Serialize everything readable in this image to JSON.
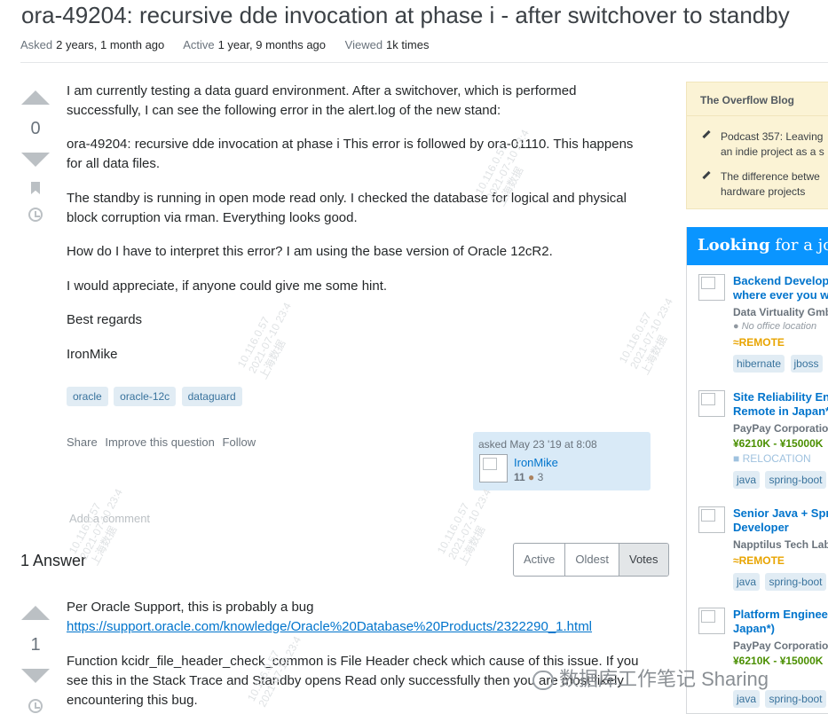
{
  "question": {
    "title": "ora-49204: recursive dde invocation at phase i - after switchover to standby",
    "asked_label": "Asked",
    "asked_value": "2 years, 1 month ago",
    "active_label": "Active",
    "active_value": "1 year, 9 months ago",
    "viewed_label": "Viewed",
    "viewed_value": "1k times",
    "score": "0",
    "paragraphs": [
      "I am currently testing a data guard environment. After a switchover, which is performed successfully, I can see the following error in the alert.log of the new stand:",
      "ora-49204: recursive dde invocation at phase i This error is followed by ora-01110. This happens for all data files.",
      "The standby is running in open mode read only. I checked the database for logical and physical block corruption via rman. Everything looks good.",
      "How do I have to interpret this error? I am using the base version of Oracle 12cR2.",
      "I would appreciate, if anyone could give me some hint.",
      "Best regards",
      "IronMike"
    ],
    "tags": [
      "oracle",
      "oracle-12c",
      "dataguard"
    ],
    "menu": [
      "Share",
      "Improve this question",
      "Follow"
    ],
    "user_card": {
      "asked": "asked May 23 '19 at 8:08",
      "name": "IronMike",
      "rep": "11",
      "bronze": "3"
    },
    "add_comment": "Add a comment"
  },
  "answers": {
    "header": "1 Answer",
    "sort_tabs": [
      "Active",
      "Oldest",
      "Votes"
    ],
    "selected_sort": "Votes",
    "answer1": {
      "score": "1",
      "line1": "Per Oracle Support, this is probably a bug",
      "link": "https://support.oracle.com/knowledge/Oracle%20Database%20Products/2322290_1.html",
      "para2": "Function kcidr_file_header_check_common is File Header check which cause of this issue. If you see this in the Stack Trace and Standby opens Read only successfully then you are most likely encountering this bug."
    }
  },
  "sidebar": {
    "blog_title": "The Overflow Blog",
    "blog_items": [
      [
        "Podcast 357: Leaving",
        "an indie project as a s"
      ],
      [
        "The difference betwe",
        "hardware projects"
      ]
    ],
    "jobs_title_bold": "Looking",
    "jobs_title_rest": " for a job",
    "jobs": [
      {
        "title_lines": [
          "Backend Develope",
          "where ever you w"
        ],
        "company": "Data Virtuality Gmb",
        "location": "No office location",
        "badge": "REMOTE",
        "tags": [
          "hibernate",
          "jboss"
        ]
      },
      {
        "title_lines": [
          "Site Reliability Eng",
          "Remote in Japan*"
        ],
        "company": "PayPay Corporation",
        "salary": "¥6210K - ¥15000K",
        "badge": "RELOCATION",
        "tags": [
          "java",
          "spring-boot"
        ]
      },
      {
        "title_lines": [
          "Senior Java + Spri",
          "Developer"
        ],
        "company": "Napptilus Tech Lab",
        "badge": "REMOTE",
        "tags": [
          "java",
          "spring-boot"
        ]
      },
      {
        "title_lines": [
          "Platform Engineer",
          "Japan*)"
        ],
        "company": "PayPay Corporation",
        "salary": "¥6210K - ¥15000K",
        "tags": [
          "java",
          "spring-boot"
        ]
      }
    ]
  },
  "watermark": {
    "line1": "10.116.0.57",
    "line2": "2021-07-10 23:4",
    "line3": "上海数据",
    "footer": "数据库工作笔记 Sharing"
  },
  "colors": {
    "link": "#0074cc",
    "tag_bg": "#e1ecf4",
    "tag_text": "#39739d",
    "jobs_header": "#0a95ff",
    "blog_bg": "#fbf3d5"
  }
}
